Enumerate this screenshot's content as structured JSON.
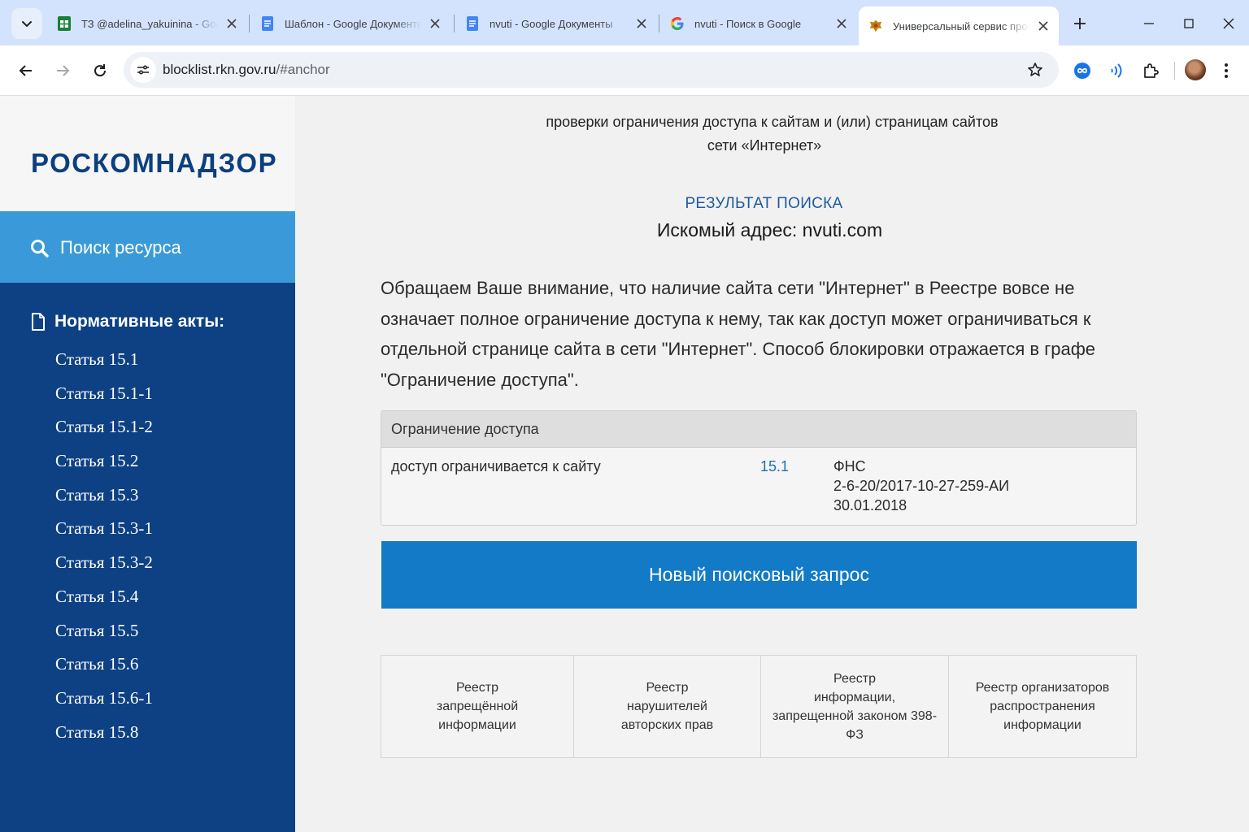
{
  "browser": {
    "tabs": [
      {
        "title": "ТЗ @adelina_yakuinina - Goo",
        "favicon": "google-sheets-icon",
        "active": false
      },
      {
        "title": "Шаблон - Google Документы",
        "favicon": "google-docs-icon",
        "active": false
      },
      {
        "title": "nvuti - Google Документы",
        "favicon": "google-docs-icon",
        "active": false
      },
      {
        "title": "nvuti - Поиск в Google",
        "favicon": "google-icon",
        "active": false
      },
      {
        "title": "Универсальный сервис проверки",
        "favicon": "rkn-emblem-icon",
        "active": true
      }
    ],
    "url_host": "blocklist.rkn.gov.ru",
    "url_path": "/#anchor"
  },
  "sidebar": {
    "logo": "РОСКОМНАДЗОР",
    "search_label": "Поиск ресурса",
    "acts_heading": "Нормативные акты:",
    "acts": [
      "Статья 15.1",
      "Статья 15.1-1",
      "Статья 15.1-2",
      "Статья 15.2",
      "Статья 15.3",
      "Статья 15.3-1",
      "Статья 15.3-2",
      "Статья 15.4",
      "Статья 15.5",
      "Статья 15.6",
      "Статья 15.6-1",
      "Статья 15.8"
    ]
  },
  "main": {
    "intro_line1": "проверки ограничения доступа к сайтам и (или) страницам сайтов",
    "intro_line2": "сети «Интернет»",
    "result_title": "РЕЗУЛЬТАТ ПОИСКА",
    "sought_address": "Искомый адрес: nvuti.com",
    "notice": "Обращаем Ваше внимание, что наличие сайта сети \"Интернет\" в Реестре вовсе не означает полное ограничение доступа к нему, так как доступ может ограничиваться к отдельной странице сайта в сети \"Интернет\". Способ блокировки отражается в графе \"Ограничение доступа\".",
    "table": {
      "header": "Ограничение доступа",
      "row": {
        "restriction": "доступ ограничивается к сайту",
        "article": "15.1",
        "authority": "ФНС",
        "decision_number": "2-6-20/2017-10-27-259-АИ",
        "decision_date": "30.01.2018"
      }
    },
    "new_search_label": "Новый поисковый запрос",
    "registries": [
      "Реестр\nзапрещённой\nинформации",
      "Реестр\nнарушителей\nавторских прав",
      "Реестр\nинформации,\nзапрещенной законом 398-ФЗ",
      "Реестр организаторов\nраспространения информации"
    ]
  },
  "colors": {
    "sidebar_bg": "#0d4183",
    "search_nav_bg": "#3a9ad9",
    "button_bg": "#137ac7",
    "logo_text": "#0d3f7f",
    "result_title": "#1e5a9c"
  }
}
